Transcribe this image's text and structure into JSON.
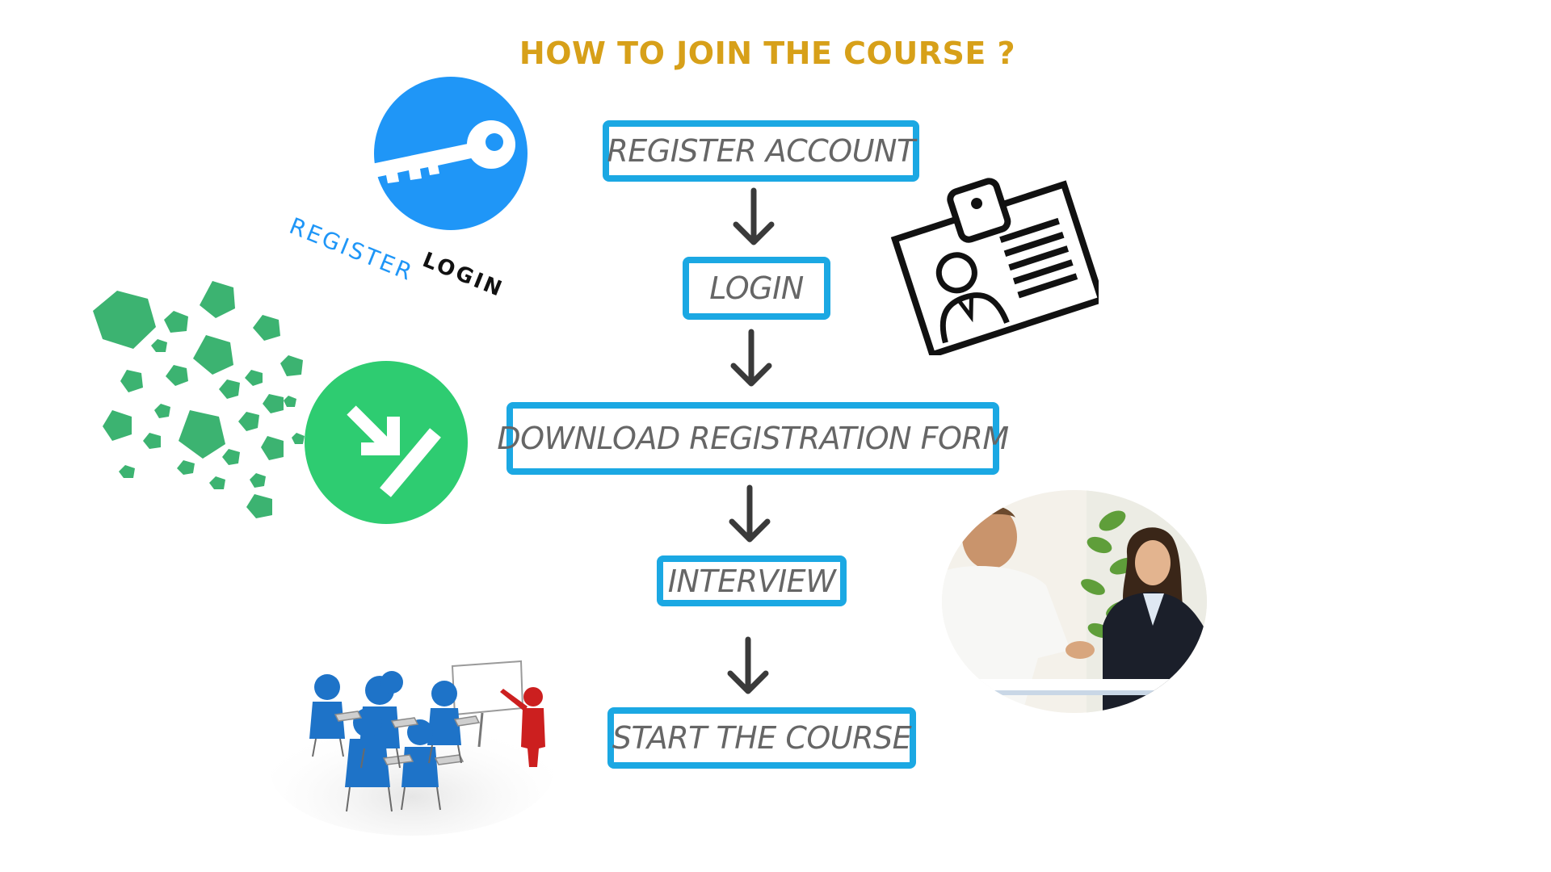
{
  "title": "HOW TO JOIN THE COURSE ?",
  "steps": [
    {
      "label": "REGISTER ACCOUNT"
    },
    {
      "label": "LOGIN"
    },
    {
      "label": "DOWNLOAD REGISTRATION FORM"
    },
    {
      "label": "INTERVIEW"
    },
    {
      "label": "START THE COURSE"
    }
  ],
  "register_logo": {
    "word1": "REGISTER",
    "word2": "LOGIN"
  },
  "colors": {
    "title": "#d7a019",
    "box_border": "#1ba8e3",
    "box_text": "#666666",
    "arrow": "#3a3a3a",
    "key_circle": "#1f96f7",
    "download_green": "#2ecc71",
    "pentagon_green": "#3cb371"
  },
  "icons": [
    "key-icon",
    "id-card-icon",
    "download-icon",
    "interview-photo",
    "classroom-illustration"
  ]
}
